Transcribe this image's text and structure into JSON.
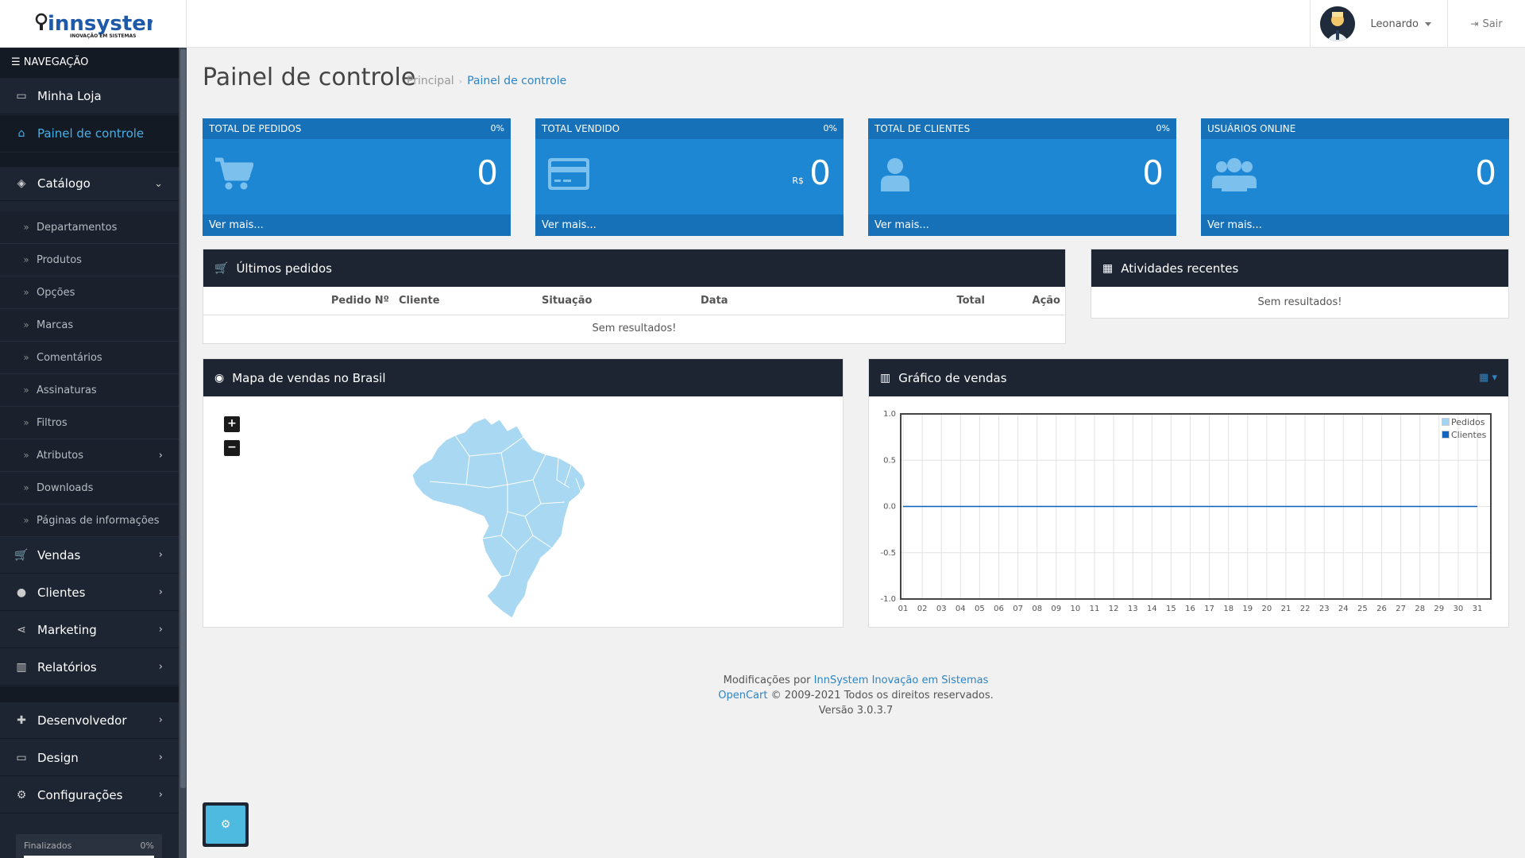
{
  "header": {
    "logo_text": "innsystem",
    "logo_tagline": "INOVAÇÃO EM SISTEMAS",
    "user_name": "Leonardo",
    "logout_label": "Sair"
  },
  "sidebar": {
    "heading": "NAVEGAÇÃO",
    "items": [
      {
        "label": "Minha Loja",
        "icon": "desktop-icon"
      },
      {
        "label": "Painel de controle",
        "icon": "home-icon"
      },
      {
        "label": "Catálogo",
        "icon": "tags-icon"
      },
      {
        "label": "Vendas",
        "icon": "cart-icon"
      },
      {
        "label": "Clientes",
        "icon": "user-icon"
      },
      {
        "label": "Marketing",
        "icon": "share-icon"
      },
      {
        "label": "Relatórios",
        "icon": "bar-chart-icon"
      },
      {
        "label": "Desenvolvedor",
        "icon": "puzzle-icon"
      },
      {
        "label": "Design",
        "icon": "desktop-icon"
      },
      {
        "label": "Configurações",
        "icon": "gear-icon"
      }
    ],
    "catalog_sub": [
      "Departamentos",
      "Produtos",
      "Opções",
      "Marcas",
      "Comentários",
      "Assinaturas",
      "Filtros",
      "Atributos",
      "Downloads",
      "Páginas de informações"
    ],
    "progress": {
      "label": "Finalizados",
      "value": "0%",
      "fraction": 0
    }
  },
  "page": {
    "title": "Painel de controle",
    "breadcrumb": [
      "Principal",
      "Painel de controle"
    ]
  },
  "tiles": [
    {
      "title": "TOTAL DE PEDIDOS",
      "percent": "0%",
      "value": "0",
      "link": "Ver mais...",
      "icon": "cart-icon"
    },
    {
      "title": "TOTAL VENDIDO",
      "percent": "0%",
      "value": "0",
      "currency": "R$",
      "link": "Ver mais...",
      "icon": "credit-card-icon"
    },
    {
      "title": "TOTAL DE CLIENTES",
      "percent": "0%",
      "value": "0",
      "link": "Ver mais...",
      "icon": "user-icon"
    },
    {
      "title": "USUÁRIOS ONLINE",
      "value": "0",
      "link": "Ver mais...",
      "icon": "users-icon"
    }
  ],
  "orders": {
    "title": "Últimos pedidos",
    "columns": [
      "Pedido Nº",
      "Cliente",
      "Situação",
      "Data",
      "Total",
      "Ação"
    ],
    "empty": "Sem resultados!"
  },
  "activity": {
    "title": "Atividades recentes",
    "empty": "Sem resultados!"
  },
  "map": {
    "title": "Mapa de vendas no Brasil",
    "zoom_in": "+",
    "zoom_out": "−"
  },
  "sales_chart": {
    "title": "Gráfico de vendas"
  },
  "chart_data": {
    "type": "line",
    "x": [
      "01",
      "02",
      "03",
      "04",
      "05",
      "06",
      "07",
      "08",
      "09",
      "10",
      "11",
      "12",
      "13",
      "14",
      "15",
      "16",
      "17",
      "18",
      "19",
      "20",
      "21",
      "22",
      "23",
      "24",
      "25",
      "26",
      "27",
      "28",
      "29",
      "30",
      "31"
    ],
    "series": [
      {
        "name": "Pedidos",
        "values": [
          0,
          0,
          0,
          0,
          0,
          0,
          0,
          0,
          0,
          0,
          0,
          0,
          0,
          0,
          0,
          0,
          0,
          0,
          0,
          0,
          0,
          0,
          0,
          0,
          0,
          0,
          0,
          0,
          0,
          0,
          0
        ],
        "color": "#9fd5f3"
      },
      {
        "name": "Clientes",
        "values": [
          0,
          0,
          0,
          0,
          0,
          0,
          0,
          0,
          0,
          0,
          0,
          0,
          0,
          0,
          0,
          0,
          0,
          0,
          0,
          0,
          0,
          0,
          0,
          0,
          0,
          0,
          0,
          0,
          0,
          0,
          0
        ],
        "color": "#1065c0"
      }
    ],
    "y_ticks": [
      "1.0",
      "0.5",
      "0.0",
      "-0.5",
      "-1.0"
    ],
    "ylim": [
      -1,
      1
    ],
    "grid": true,
    "legend": "top-right"
  },
  "footer": {
    "line1_prefix": "Modificações por ",
    "line1_link": "InnSystem Inovação em Sistemas",
    "line2_link": "OpenCart",
    "line2_suffix": " © 2009-2021 Todos os direitos reservados.",
    "line3": "Versão 3.0.3.7"
  },
  "colors": {
    "accent": "#1e87d4",
    "sidebar_bg": "#1d2532",
    "map_fill": "#a8d8f2"
  }
}
